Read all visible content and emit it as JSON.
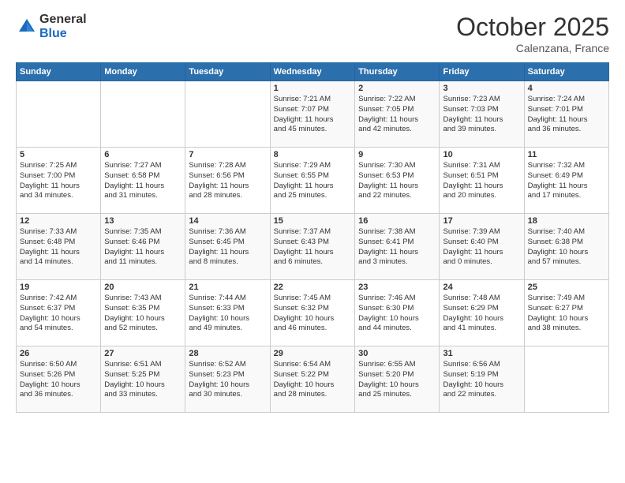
{
  "header": {
    "logo_general": "General",
    "logo_blue": "Blue",
    "month_title": "October 2025",
    "location": "Calenzana, France"
  },
  "weekdays": [
    "Sunday",
    "Monday",
    "Tuesday",
    "Wednesday",
    "Thursday",
    "Friday",
    "Saturday"
  ],
  "weeks": [
    [
      {
        "day": "",
        "info": ""
      },
      {
        "day": "",
        "info": ""
      },
      {
        "day": "",
        "info": ""
      },
      {
        "day": "1",
        "info": "Sunrise: 7:21 AM\nSunset: 7:07 PM\nDaylight: 11 hours\nand 45 minutes."
      },
      {
        "day": "2",
        "info": "Sunrise: 7:22 AM\nSunset: 7:05 PM\nDaylight: 11 hours\nand 42 minutes."
      },
      {
        "day": "3",
        "info": "Sunrise: 7:23 AM\nSunset: 7:03 PM\nDaylight: 11 hours\nand 39 minutes."
      },
      {
        "day": "4",
        "info": "Sunrise: 7:24 AM\nSunset: 7:01 PM\nDaylight: 11 hours\nand 36 minutes."
      }
    ],
    [
      {
        "day": "5",
        "info": "Sunrise: 7:25 AM\nSunset: 7:00 PM\nDaylight: 11 hours\nand 34 minutes."
      },
      {
        "day": "6",
        "info": "Sunrise: 7:27 AM\nSunset: 6:58 PM\nDaylight: 11 hours\nand 31 minutes."
      },
      {
        "day": "7",
        "info": "Sunrise: 7:28 AM\nSunset: 6:56 PM\nDaylight: 11 hours\nand 28 minutes."
      },
      {
        "day": "8",
        "info": "Sunrise: 7:29 AM\nSunset: 6:55 PM\nDaylight: 11 hours\nand 25 minutes."
      },
      {
        "day": "9",
        "info": "Sunrise: 7:30 AM\nSunset: 6:53 PM\nDaylight: 11 hours\nand 22 minutes."
      },
      {
        "day": "10",
        "info": "Sunrise: 7:31 AM\nSunset: 6:51 PM\nDaylight: 11 hours\nand 20 minutes."
      },
      {
        "day": "11",
        "info": "Sunrise: 7:32 AM\nSunset: 6:49 PM\nDaylight: 11 hours\nand 17 minutes."
      }
    ],
    [
      {
        "day": "12",
        "info": "Sunrise: 7:33 AM\nSunset: 6:48 PM\nDaylight: 11 hours\nand 14 minutes."
      },
      {
        "day": "13",
        "info": "Sunrise: 7:35 AM\nSunset: 6:46 PM\nDaylight: 11 hours\nand 11 minutes."
      },
      {
        "day": "14",
        "info": "Sunrise: 7:36 AM\nSunset: 6:45 PM\nDaylight: 11 hours\nand 8 minutes."
      },
      {
        "day": "15",
        "info": "Sunrise: 7:37 AM\nSunset: 6:43 PM\nDaylight: 11 hours\nand 6 minutes."
      },
      {
        "day": "16",
        "info": "Sunrise: 7:38 AM\nSunset: 6:41 PM\nDaylight: 11 hours\nand 3 minutes."
      },
      {
        "day": "17",
        "info": "Sunrise: 7:39 AM\nSunset: 6:40 PM\nDaylight: 11 hours\nand 0 minutes."
      },
      {
        "day": "18",
        "info": "Sunrise: 7:40 AM\nSunset: 6:38 PM\nDaylight: 10 hours\nand 57 minutes."
      }
    ],
    [
      {
        "day": "19",
        "info": "Sunrise: 7:42 AM\nSunset: 6:37 PM\nDaylight: 10 hours\nand 54 minutes."
      },
      {
        "day": "20",
        "info": "Sunrise: 7:43 AM\nSunset: 6:35 PM\nDaylight: 10 hours\nand 52 minutes."
      },
      {
        "day": "21",
        "info": "Sunrise: 7:44 AM\nSunset: 6:33 PM\nDaylight: 10 hours\nand 49 minutes."
      },
      {
        "day": "22",
        "info": "Sunrise: 7:45 AM\nSunset: 6:32 PM\nDaylight: 10 hours\nand 46 minutes."
      },
      {
        "day": "23",
        "info": "Sunrise: 7:46 AM\nSunset: 6:30 PM\nDaylight: 10 hours\nand 44 minutes."
      },
      {
        "day": "24",
        "info": "Sunrise: 7:48 AM\nSunset: 6:29 PM\nDaylight: 10 hours\nand 41 minutes."
      },
      {
        "day": "25",
        "info": "Sunrise: 7:49 AM\nSunset: 6:27 PM\nDaylight: 10 hours\nand 38 minutes."
      }
    ],
    [
      {
        "day": "26",
        "info": "Sunrise: 6:50 AM\nSunset: 5:26 PM\nDaylight: 10 hours\nand 36 minutes."
      },
      {
        "day": "27",
        "info": "Sunrise: 6:51 AM\nSunset: 5:25 PM\nDaylight: 10 hours\nand 33 minutes."
      },
      {
        "day": "28",
        "info": "Sunrise: 6:52 AM\nSunset: 5:23 PM\nDaylight: 10 hours\nand 30 minutes."
      },
      {
        "day": "29",
        "info": "Sunrise: 6:54 AM\nSunset: 5:22 PM\nDaylight: 10 hours\nand 28 minutes."
      },
      {
        "day": "30",
        "info": "Sunrise: 6:55 AM\nSunset: 5:20 PM\nDaylight: 10 hours\nand 25 minutes."
      },
      {
        "day": "31",
        "info": "Sunrise: 6:56 AM\nSunset: 5:19 PM\nDaylight: 10 hours\nand 22 minutes."
      },
      {
        "day": "",
        "info": ""
      }
    ]
  ]
}
